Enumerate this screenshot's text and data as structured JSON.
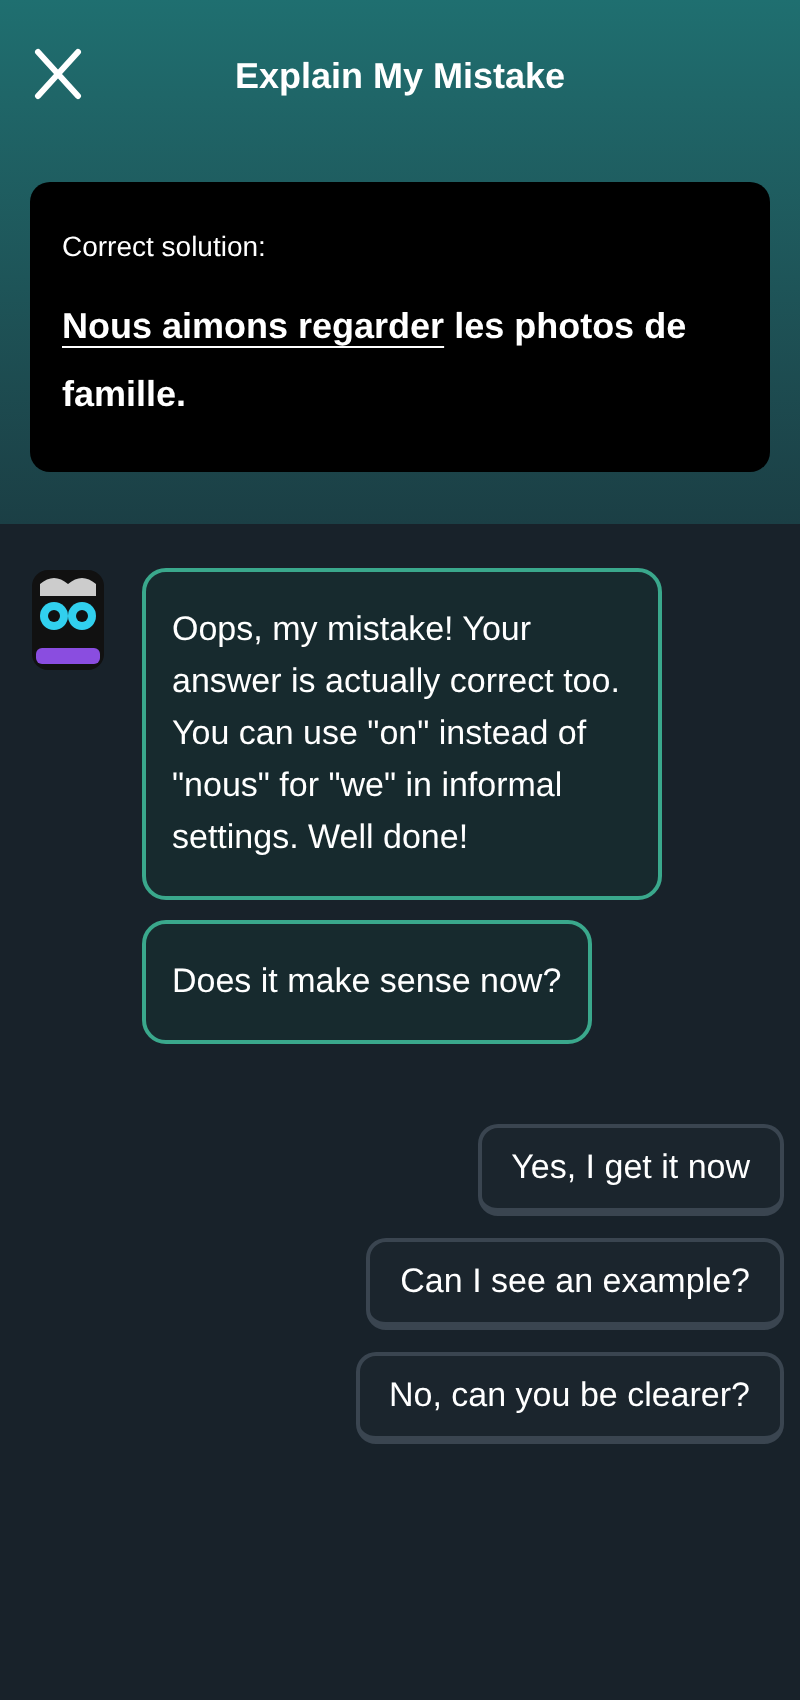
{
  "header": {
    "title": "Explain My Mistake"
  },
  "solution_card": {
    "label": "Correct solution:",
    "highlighted": "Nous aimons regarder",
    "rest": "les photos de famille."
  },
  "messages": [
    {
      "text": "Oops, my mistake! Your answer is actually correct too. You can use \"on\" instead of \"nous\" for \"we\" in informal settings. Well done!",
      "avatar": true
    },
    {
      "text": "Does it make sense now?",
      "avatar": false
    }
  ],
  "replies": [
    "Yes, I get it now",
    "Can I see an example?",
    "No, can you be clearer?"
  ]
}
